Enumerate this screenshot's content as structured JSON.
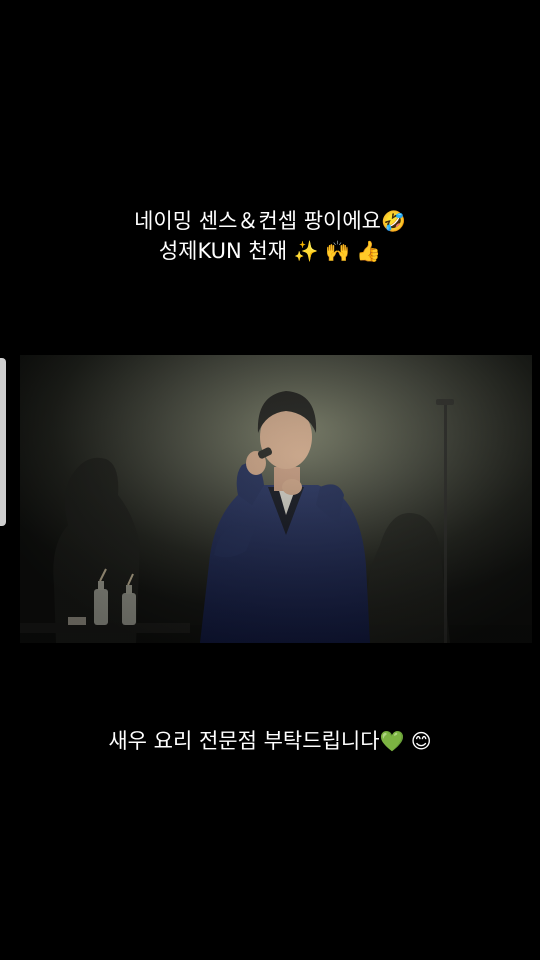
{
  "captions": {
    "top_line1": "네이밍 센스＆컨셉 팡이에요",
    "top_line1_emoji": "🤣",
    "top_line2": "성제KUN 천재",
    "top_line2_emojis": "✨ 🙌 👍",
    "bottom": "새우 요리 전문점 부탁드립니다",
    "bottom_emojis": "💚 😊"
  },
  "video": {
    "scene": "performer on stage with microphone"
  }
}
